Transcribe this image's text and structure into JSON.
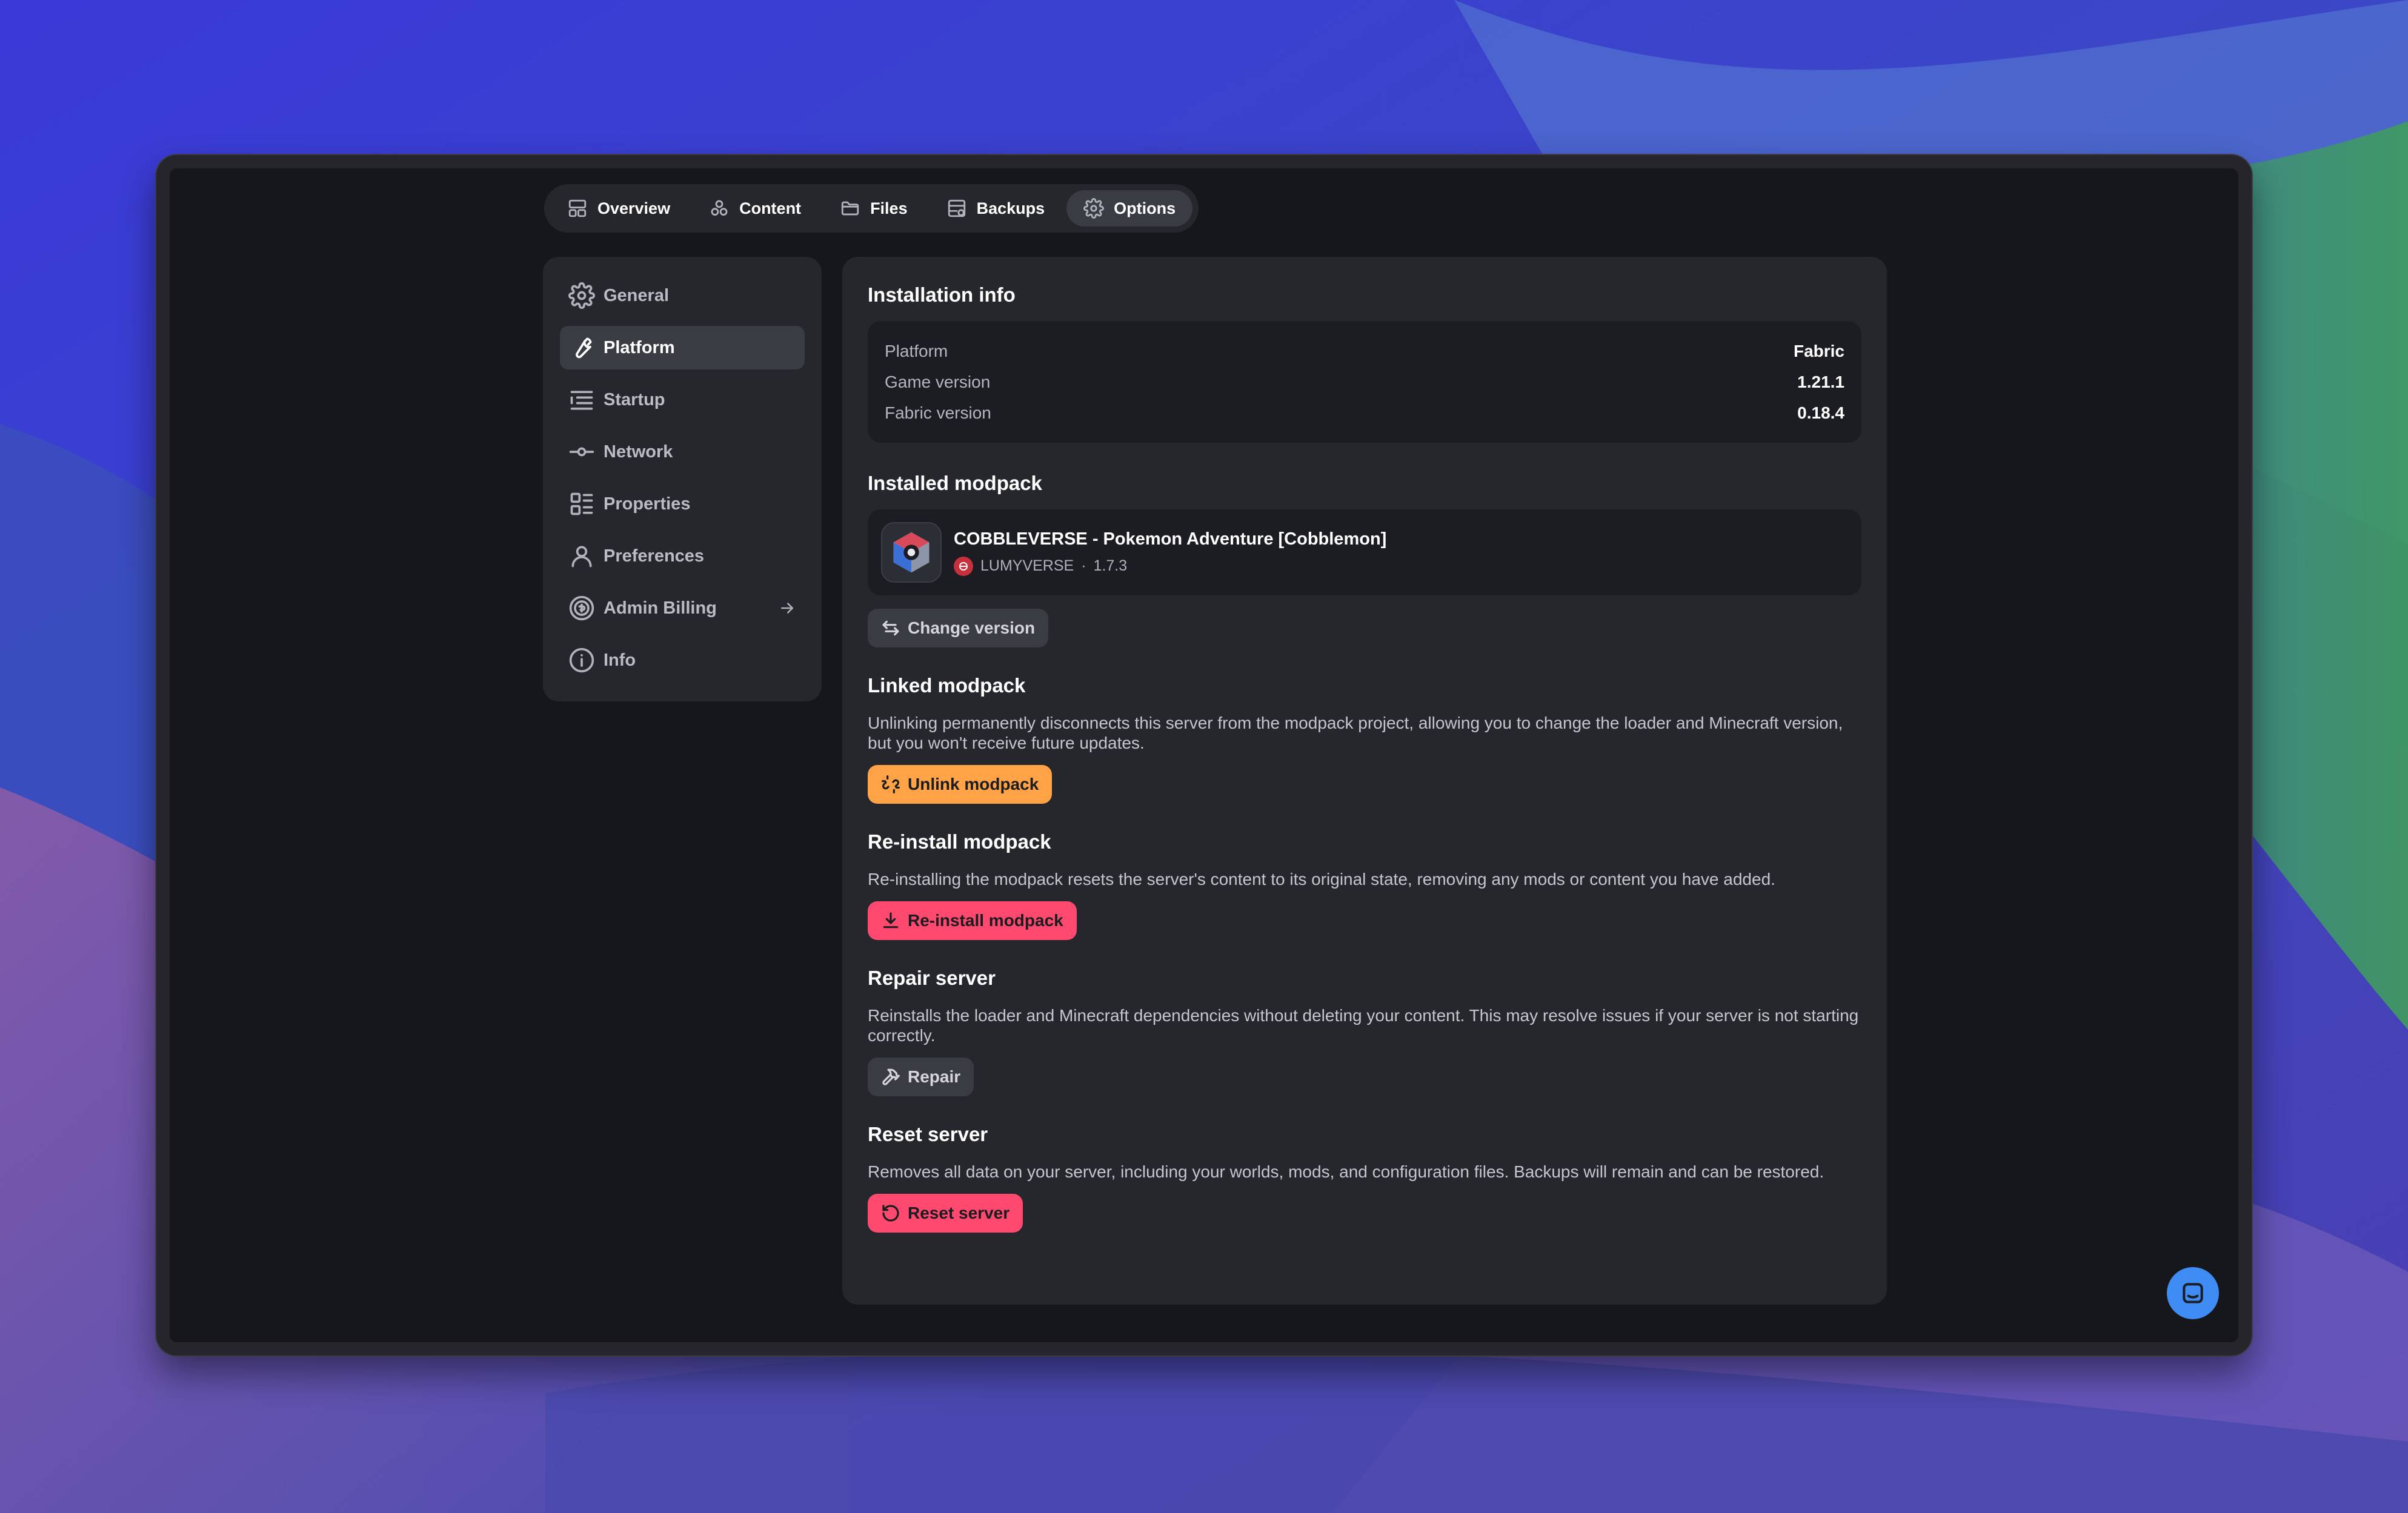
{
  "nav": {
    "tabs": [
      {
        "label": "Overview",
        "icon": "overview-icon"
      },
      {
        "label": "Content",
        "icon": "content-icon"
      },
      {
        "label": "Files",
        "icon": "folder-icon"
      },
      {
        "label": "Backups",
        "icon": "backups-icon"
      },
      {
        "label": "Options",
        "icon": "gear-icon",
        "active": true
      }
    ]
  },
  "sidebar": {
    "items": [
      {
        "label": "General",
        "icon": "gear-icon"
      },
      {
        "label": "Platform",
        "icon": "wrench-icon",
        "active": true
      },
      {
        "label": "Startup",
        "icon": "list-icon"
      },
      {
        "label": "Network",
        "icon": "network-icon"
      },
      {
        "label": "Properties",
        "icon": "properties-icon"
      },
      {
        "label": "Preferences",
        "icon": "user-icon"
      },
      {
        "label": "Admin Billing",
        "icon": "billing-icon",
        "external_arrow": true
      },
      {
        "label": "Info",
        "icon": "info-icon"
      }
    ]
  },
  "installation": {
    "title": "Installation info",
    "rows": [
      {
        "key": "Platform",
        "value": "Fabric"
      },
      {
        "key": "Game version",
        "value": "1.21.1"
      },
      {
        "key": "Fabric version",
        "value": "0.18.4"
      }
    ]
  },
  "installed_modpack": {
    "title": "Installed modpack",
    "name": "COBBLEVERSE - Pokemon Adventure [Cobblemon]",
    "author": "LUMYVERSE",
    "separator": "·",
    "version": "1.7.3",
    "change_version_label": "Change version"
  },
  "linked_modpack": {
    "title": "Linked modpack",
    "description": "Unlinking permanently disconnects this server from the modpack project, allowing you to change the loader and Minecraft version, but you won't receive future updates.",
    "button_label": "Unlink modpack"
  },
  "reinstall_modpack": {
    "title": "Re-install modpack",
    "description": "Re-installing the modpack resets the server's content to its original state, removing any mods or content you have added.",
    "button_label": "Re-install modpack"
  },
  "repair_server": {
    "title": "Repair server",
    "description": "Reinstalls the loader and Minecraft dependencies without deleting your content. This may resolve issues if your server is not starting correctly.",
    "button_label": "Repair"
  },
  "reset_server": {
    "title": "Reset server",
    "description": "Removes all data on your server, including your worlds, mods, and configuration files. Backups will remain and can be restored.",
    "button_label": "Reset server"
  },
  "colors": {
    "accent_orange": "#ffa346",
    "danger_red": "#ff496e",
    "chat_blue": "#3e8cf4"
  }
}
